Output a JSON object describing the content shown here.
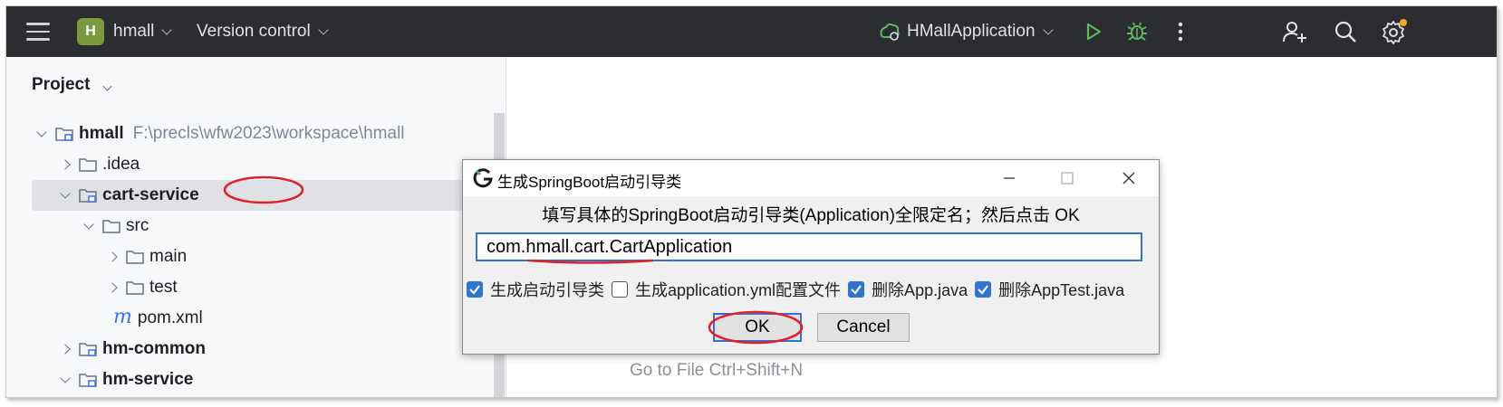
{
  "topbar": {
    "project_initial": "H",
    "project_name": "hmall",
    "vcs_label": "Version control",
    "run_config": "HMallApplication",
    "icons": [
      "hamburger-icon",
      "run-icon",
      "debug-icon",
      "more-icon",
      "add-user-icon",
      "search-icon",
      "settings-icon"
    ],
    "colors": {
      "bg": "#2b2d30",
      "run": "#5fb860",
      "debug": "#5fb860",
      "badge": "#7c9a3d",
      "notify": "#f5a623"
    }
  },
  "project_panel": {
    "title": "Project",
    "tree": [
      {
        "label": "hmall",
        "path": "F:\\precls\\wfw2023\\workspace\\hmall",
        "bold": true,
        "expanded": true
      },
      {
        "label": ".idea"
      },
      {
        "label": "cart-service",
        "bold": true,
        "expanded": true,
        "selected": true
      },
      {
        "label": "src",
        "expanded": true
      },
      {
        "label": "main"
      },
      {
        "label": "test"
      },
      {
        "label": "pom.xml",
        "file_icon": "m"
      },
      {
        "label": "hm-common",
        "bold": true
      },
      {
        "label": "hm-service",
        "bold": true
      }
    ]
  },
  "editor": {
    "hint": "Go to File Ctrl+Shift+N"
  },
  "dialog": {
    "title": "生成SpringBoot启动引导类",
    "instruction": "填写具体的SpringBoot启动引导类(Application)全限定名；然后点击 OK",
    "input_value": "com.hmall.cart.CartApplication",
    "checkboxes": [
      {
        "label": "生成启动引导类",
        "checked": true
      },
      {
        "label": "生成application.yml配置文件",
        "checked": false
      },
      {
        "label": "删除App.java",
        "checked": true
      },
      {
        "label": "删除AppTest.java",
        "checked": true
      }
    ],
    "ok_label": "OK",
    "cancel_label": "Cancel",
    "accent_color": "#2f74d0"
  }
}
